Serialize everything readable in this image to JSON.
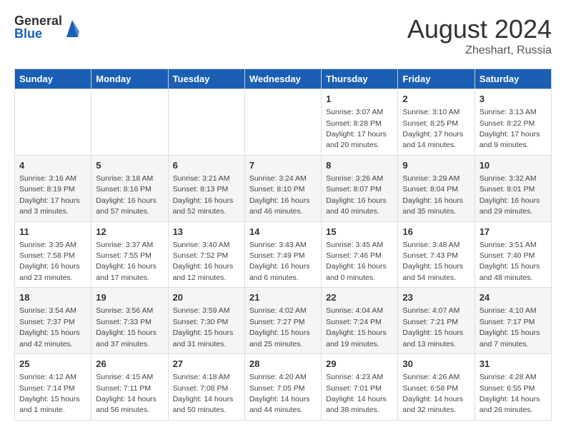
{
  "header": {
    "logo_general": "General",
    "logo_blue": "Blue",
    "month_year": "August 2024",
    "location": "Zheshart, Russia"
  },
  "weekdays": [
    "Sunday",
    "Monday",
    "Tuesday",
    "Wednesday",
    "Thursday",
    "Friday",
    "Saturday"
  ],
  "weeks": [
    [
      null,
      null,
      null,
      null,
      {
        "day": "1",
        "sunrise": "3:07 AM",
        "sunset": "8:28 PM",
        "daylight": "17 hours and 20 minutes."
      },
      {
        "day": "2",
        "sunrise": "3:10 AM",
        "sunset": "8:25 PM",
        "daylight": "17 hours and 14 minutes."
      },
      {
        "day": "3",
        "sunrise": "3:13 AM",
        "sunset": "8:22 PM",
        "daylight": "17 hours and 9 minutes."
      }
    ],
    [
      {
        "day": "4",
        "sunrise": "3:16 AM",
        "sunset": "8:19 PM",
        "daylight": "17 hours and 3 minutes."
      },
      {
        "day": "5",
        "sunrise": "3:18 AM",
        "sunset": "8:16 PM",
        "daylight": "16 hours and 57 minutes."
      },
      {
        "day": "6",
        "sunrise": "3:21 AM",
        "sunset": "8:13 PM",
        "daylight": "16 hours and 52 minutes."
      },
      {
        "day": "7",
        "sunrise": "3:24 AM",
        "sunset": "8:10 PM",
        "daylight": "16 hours and 46 minutes."
      },
      {
        "day": "8",
        "sunrise": "3:26 AM",
        "sunset": "8:07 PM",
        "daylight": "16 hours and 40 minutes."
      },
      {
        "day": "9",
        "sunrise": "3:29 AM",
        "sunset": "8:04 PM",
        "daylight": "16 hours and 35 minutes."
      },
      {
        "day": "10",
        "sunrise": "3:32 AM",
        "sunset": "8:01 PM",
        "daylight": "16 hours and 29 minutes."
      }
    ],
    [
      {
        "day": "11",
        "sunrise": "3:35 AM",
        "sunset": "7:58 PM",
        "daylight": "16 hours and 23 minutes."
      },
      {
        "day": "12",
        "sunrise": "3:37 AM",
        "sunset": "7:55 PM",
        "daylight": "16 hours and 17 minutes."
      },
      {
        "day": "13",
        "sunrise": "3:40 AM",
        "sunset": "7:52 PM",
        "daylight": "16 hours and 12 minutes."
      },
      {
        "day": "14",
        "sunrise": "3:43 AM",
        "sunset": "7:49 PM",
        "daylight": "16 hours and 6 minutes."
      },
      {
        "day": "15",
        "sunrise": "3:45 AM",
        "sunset": "7:46 PM",
        "daylight": "16 hours and 0 minutes."
      },
      {
        "day": "16",
        "sunrise": "3:48 AM",
        "sunset": "7:43 PM",
        "daylight": "15 hours and 54 minutes."
      },
      {
        "day": "17",
        "sunrise": "3:51 AM",
        "sunset": "7:40 PM",
        "daylight": "15 hours and 48 minutes."
      }
    ],
    [
      {
        "day": "18",
        "sunrise": "3:54 AM",
        "sunset": "7:37 PM",
        "daylight": "15 hours and 42 minutes."
      },
      {
        "day": "19",
        "sunrise": "3:56 AM",
        "sunset": "7:33 PM",
        "daylight": "15 hours and 37 minutes."
      },
      {
        "day": "20",
        "sunrise": "3:59 AM",
        "sunset": "7:30 PM",
        "daylight": "15 hours and 31 minutes."
      },
      {
        "day": "21",
        "sunrise": "4:02 AM",
        "sunset": "7:27 PM",
        "daylight": "15 hours and 25 minutes."
      },
      {
        "day": "22",
        "sunrise": "4:04 AM",
        "sunset": "7:24 PM",
        "daylight": "15 hours and 19 minutes."
      },
      {
        "day": "23",
        "sunrise": "4:07 AM",
        "sunset": "7:21 PM",
        "daylight": "15 hours and 13 minutes."
      },
      {
        "day": "24",
        "sunrise": "4:10 AM",
        "sunset": "7:17 PM",
        "daylight": "15 hours and 7 minutes."
      }
    ],
    [
      {
        "day": "25",
        "sunrise": "4:12 AM",
        "sunset": "7:14 PM",
        "daylight": "15 hours and 1 minute."
      },
      {
        "day": "26",
        "sunrise": "4:15 AM",
        "sunset": "7:11 PM",
        "daylight": "14 hours and 56 minutes."
      },
      {
        "day": "27",
        "sunrise": "4:18 AM",
        "sunset": "7:08 PM",
        "daylight": "14 hours and 50 minutes."
      },
      {
        "day": "28",
        "sunrise": "4:20 AM",
        "sunset": "7:05 PM",
        "daylight": "14 hours and 44 minutes."
      },
      {
        "day": "29",
        "sunrise": "4:23 AM",
        "sunset": "7:01 PM",
        "daylight": "14 hours and 38 minutes."
      },
      {
        "day": "30",
        "sunrise": "4:26 AM",
        "sunset": "6:58 PM",
        "daylight": "14 hours and 32 minutes."
      },
      {
        "day": "31",
        "sunrise": "4:28 AM",
        "sunset": "6:55 PM",
        "daylight": "14 hours and 26 minutes."
      }
    ]
  ]
}
